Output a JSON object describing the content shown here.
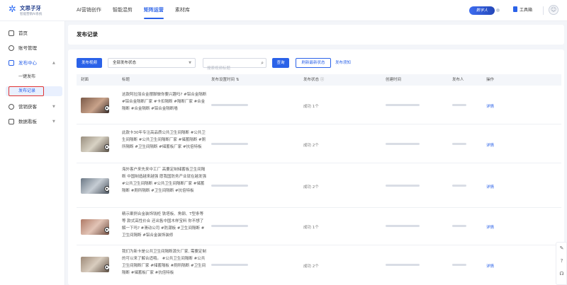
{
  "brand": {
    "name": "文思子牙",
    "subtitle": "智能营销AI系统",
    "accent": "#2b62e8"
  },
  "nav": [
    {
      "label": "AI营销创作"
    },
    {
      "label": "智能混剪"
    },
    {
      "label": "矩阵运营"
    },
    {
      "label": "素材库"
    }
  ],
  "header": {
    "vip_label": "数字人",
    "tool_label": "工具箱"
  },
  "sidebar": {
    "items": [
      {
        "label": "首页",
        "icon": "home-icon"
      },
      {
        "label": "账号管理",
        "icon": "user-icon"
      },
      {
        "label": "发布中心",
        "icon": "send-icon"
      },
      {
        "label": "营销获客",
        "icon": "target-icon"
      },
      {
        "label": "数据看板",
        "icon": "chart-icon"
      }
    ],
    "sub_items": [
      {
        "label": "一键发布"
      },
      {
        "label": "发布记录"
      }
    ]
  },
  "page": {
    "title": "发布记录"
  },
  "toolbar": {
    "publish_button": "发布视频",
    "status_select": "全部发布状态",
    "search_placeholder": "搜索视频标题",
    "query_button": "查询",
    "refresh_button": "刷新最新状态",
    "notice_link": "发布须知"
  },
  "table": {
    "columns": [
      "封面",
      "标题",
      "发布设置时间",
      "发布状态",
      "创建时间",
      "发布人",
      "操作"
    ],
    "rows": [
      {
        "title": "这款阿拉丽合金摆脚做你要兴趣吗? #铝合金隔断 #铝合金隔断厂家 #卡扣隔断 #隔断厂家 #合金隔断 #合金隔断 #铝合金隔断墙",
        "status": "成功 1个",
        "op": "详情"
      },
      {
        "title": "此款卡30年专注高品质公共卫生间隔断 #公共卫生间隔断 #公共卫生间隔断厂家 #储蓄隔断 #厕所隔断 #卫生间隔断 #储蓄板厂家 #抗倍特板",
        "status": "成功 2个",
        "op": "详情"
      },
      {
        "title": "海外客户来先来中工厂 高要定制储蓄板卫生间隔断 中国制造越来越强 愿我国防务产业就在越发强 #公共卫生间隔断 #公共卫生间隔断厂家 #储蓄隔断 #厕所隔断 #卫生间隔断 #抗倍特板",
        "status": "成功 2个",
        "op": "详情"
      },
      {
        "title": "精示案例合金装饰钱柜 铁塔板、角钢、T型条等等 款式高性价合 还出售中国木样宝料 你不想了解一下吗? #滑动公司 #防潮板 #卫生间隔断 #卫生间隔断 #铝合金装饰装修",
        "status": "成功 1个",
        "op": "详情"
      },
      {
        "title": "我们为新卡是公共卫生间隔断源头厂家, 需要定制的可以来了解合适哦。 #公共卫生间隔断 #公共卫生间隔断厂家 #储蓄隔板 #厕所隔断 #卫生间隔断 #储蓄板厂家 #抗倍特板",
        "status": "成功 2个",
        "op": "详情"
      }
    ]
  },
  "float_bar": [
    {
      "icon": "edit-icon"
    },
    {
      "icon": "help-icon"
    },
    {
      "icon": "headset-icon"
    }
  ]
}
